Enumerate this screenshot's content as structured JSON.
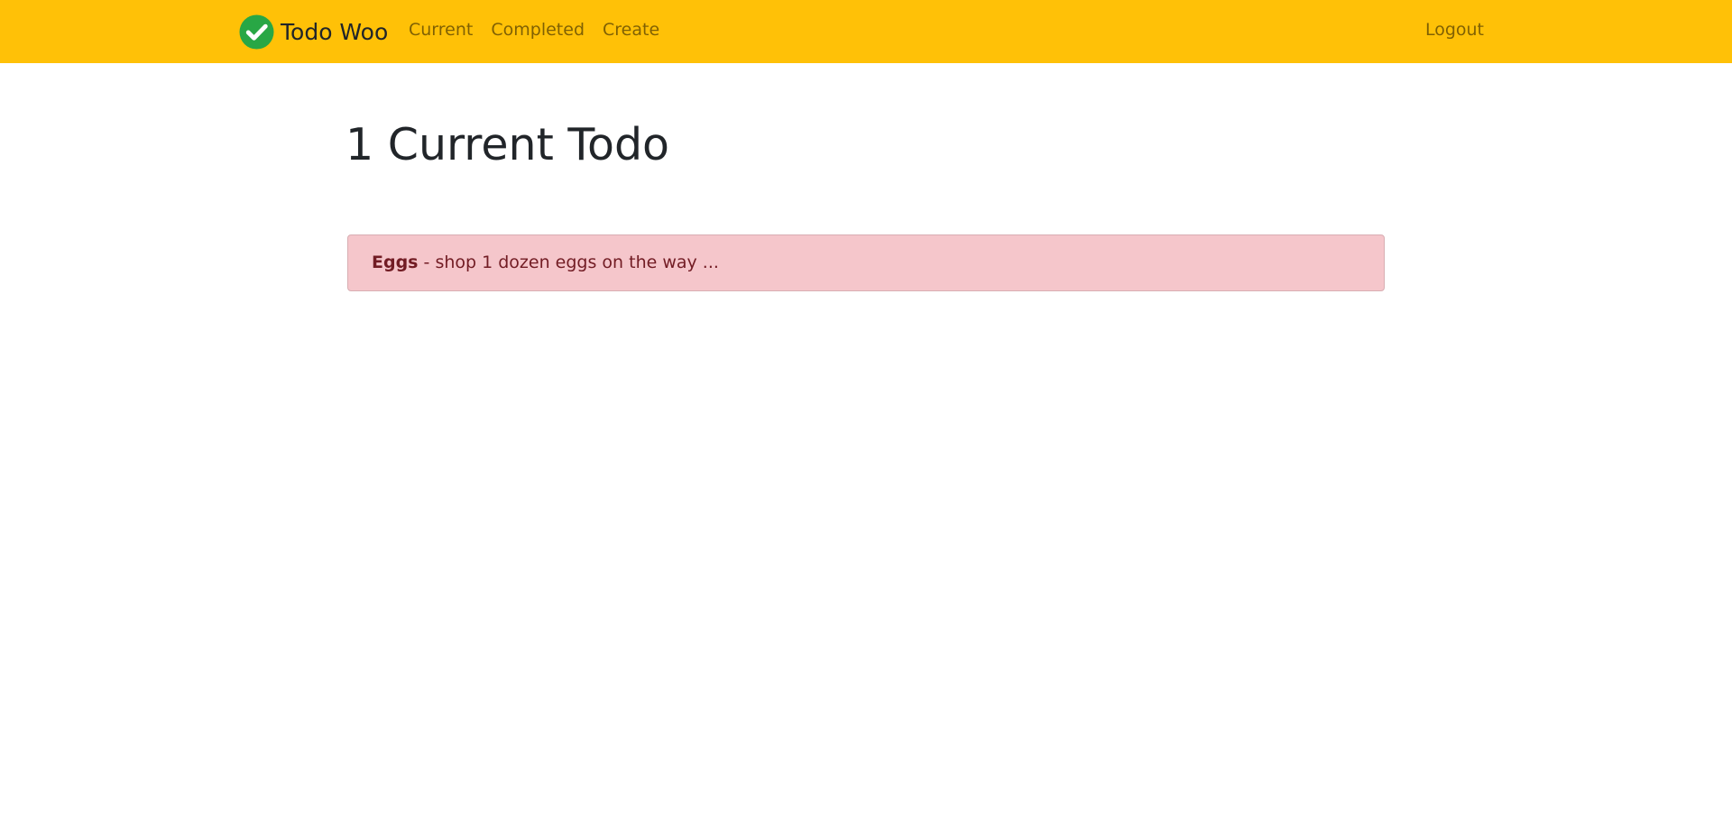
{
  "brand": {
    "name": "Todo Woo",
    "logo_icon": "check-circle-icon",
    "logo_color": "#28a745"
  },
  "nav": {
    "links": [
      "Current",
      "Completed",
      "Create"
    ],
    "logout": "Logout"
  },
  "colors": {
    "navbar_bg": "#ffc107",
    "todo_bg": "#f5c6cb",
    "todo_text": "#721c24"
  },
  "main": {
    "title": "1 Current Todo",
    "todos": [
      {
        "title": "Eggs",
        "separator": " - ",
        "memo": "shop 1 dozen eggs on the way ..."
      }
    ]
  }
}
